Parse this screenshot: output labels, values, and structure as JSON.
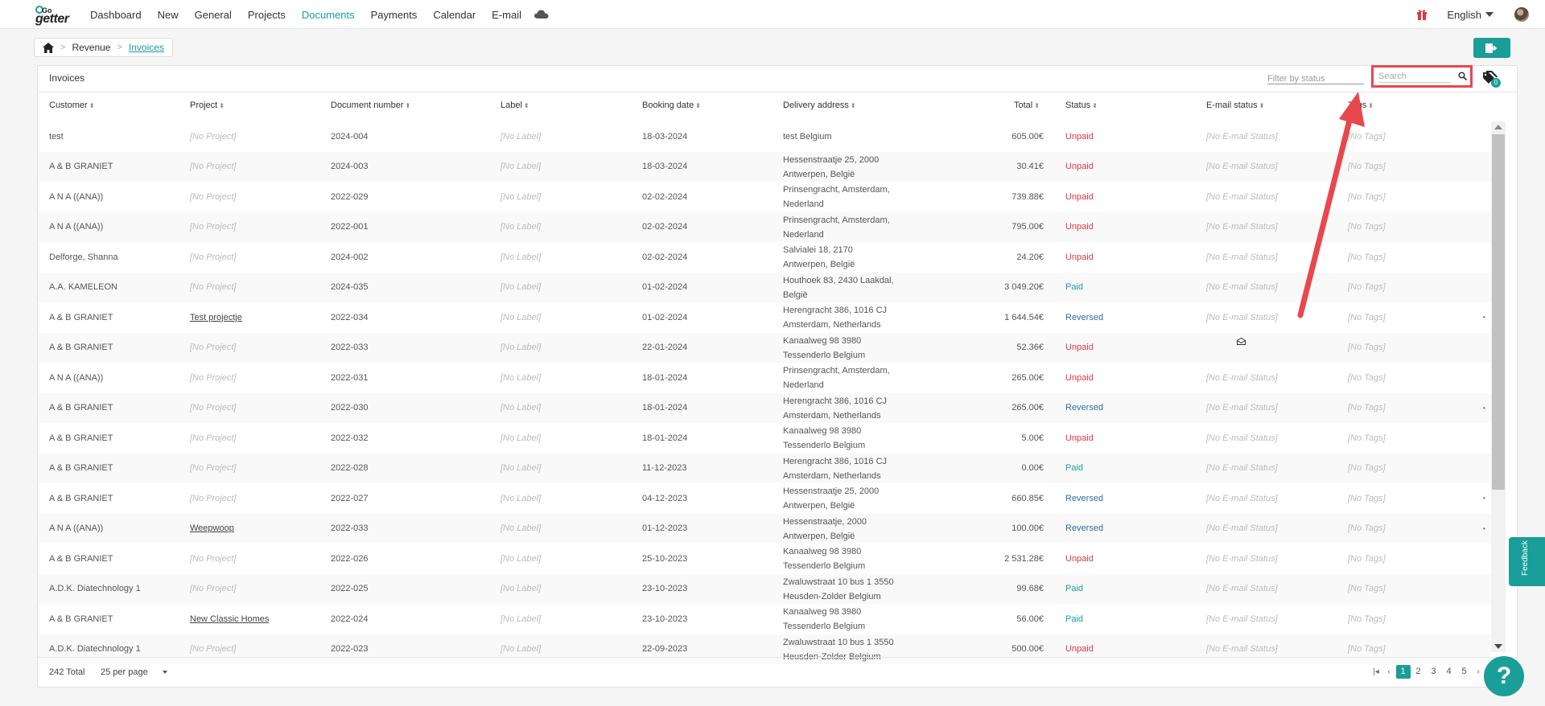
{
  "nav": {
    "logo_top": "Go",
    "logo_bottom": "getter",
    "items": [
      "Dashboard",
      "New",
      "General",
      "Projects",
      "Documents",
      "Payments",
      "Calendar",
      "E-mail"
    ],
    "active": "Documents",
    "language": "English"
  },
  "breadcrumb": {
    "items": [
      "Revenue",
      "Invoices"
    ]
  },
  "panel": {
    "title": "Invoices",
    "filter_placeholder": "Filter by status",
    "search_placeholder": "Search",
    "tag_count": "0"
  },
  "columns": [
    "Customer",
    "Project",
    "Document number",
    "Label",
    "Booking date",
    "Delivery address",
    "Total",
    "Status",
    "E-mail status",
    "Tags"
  ],
  "rows": [
    {
      "customer": "test",
      "project": "[No Project]",
      "doc": "2024-004",
      "label": "[No Label]",
      "date": "18-03-2024",
      "addr1": "test Belgium",
      "addr2": "",
      "total": "605.00€",
      "status": "Unpaid",
      "email": "[No E-mail Status]",
      "tags": "[No Tags]"
    },
    {
      "customer": "A & B GRANIET",
      "project": "[No Project]",
      "doc": "2024-003",
      "label": "[No Label]",
      "date": "18-03-2024",
      "addr1": "Hessenstraatje 25, 2000",
      "addr2": "Antwerpen, België",
      "total": "30.41€",
      "status": "Unpaid",
      "email": "[No E-mail Status]",
      "tags": "[No Tags]"
    },
    {
      "customer": "A N A ((ANA))",
      "project": "[No Project]",
      "doc": "2022-029",
      "label": "[No Label]",
      "date": "02-02-2024",
      "addr1": "Prinsengracht, Amsterdam,",
      "addr2": "Nederland",
      "total": "739.88€",
      "status": "Unpaid",
      "email": "[No E-mail Status]",
      "tags": "[No Tags]"
    },
    {
      "customer": "A N A ((ANA))",
      "project": "[No Project]",
      "doc": "2022-001",
      "label": "[No Label]",
      "date": "02-02-2024",
      "addr1": "Prinsengracht, Amsterdam,",
      "addr2": "Nederland",
      "total": "795.00€",
      "status": "Unpaid",
      "email": "[No E-mail Status]",
      "tags": "[No Tags]"
    },
    {
      "customer": "Delforge, Shanna",
      "project": "[No Project]",
      "doc": "2024-002",
      "label": "[No Label]",
      "date": "02-02-2024",
      "addr1": "Salvialei 18, 2170",
      "addr2": "Antwerpen, België",
      "total": "24.20€",
      "status": "Unpaid",
      "email": "[No E-mail Status]",
      "tags": "[No Tags]"
    },
    {
      "customer": "A.A. KAMELEON",
      "project": "[No Project]",
      "doc": "2024-035",
      "label": "[No Label]",
      "date": "01-02-2024",
      "addr1": "Houthoek 83, 2430 Laakdal,",
      "addr2": "België",
      "total": "3 049.20€",
      "status": "Paid",
      "email": "[No E-mail Status]",
      "tags": "[No Tags]"
    },
    {
      "customer": "A & B GRANIET",
      "project": "Test projectje",
      "doc": "2022-034",
      "label": "[No Label]",
      "date": "01-02-2024",
      "addr1": "Herengracht 386, 1016 CJ",
      "addr2": "Amsterdam, Netherlands",
      "total": "1 644.54€",
      "status": "Reversed",
      "email": "[No E-mail Status]",
      "tags": "[No Tags]"
    },
    {
      "customer": "A & B GRANIET",
      "project": "[No Project]",
      "doc": "2022-033",
      "label": "[No Label]",
      "date": "22-01-2024",
      "addr1": "Kanaalweg 98 3980",
      "addr2": "Tessenderlo Belgium",
      "total": "52.36€",
      "status": "Unpaid",
      "email": "",
      "tags": "[No Tags]"
    },
    {
      "customer": "A N A ((ANA))",
      "project": "[No Project]",
      "doc": "2022-031",
      "label": "[No Label]",
      "date": "18-01-2024",
      "addr1": "Prinsengracht, Amsterdam,",
      "addr2": "Nederland",
      "total": "265.00€",
      "status": "Unpaid",
      "email": "[No E-mail Status]",
      "tags": "[No Tags]"
    },
    {
      "customer": "A & B GRANIET",
      "project": "[No Project]",
      "doc": "2022-030",
      "label": "[No Label]",
      "date": "18-01-2024",
      "addr1": "Herengracht 386, 1016 CJ",
      "addr2": "Amsterdam, Netherlands",
      "total": "265.00€",
      "status": "Reversed",
      "email": "[No E-mail Status]",
      "tags": "[No Tags]"
    },
    {
      "customer": "A & B GRANIET",
      "project": "[No Project]",
      "doc": "2022-032",
      "label": "[No Label]",
      "date": "18-01-2024",
      "addr1": "Kanaalweg 98 3980",
      "addr2": "Tessenderlo Belgium",
      "total": "5.00€",
      "status": "Unpaid",
      "email": "[No E-mail Status]",
      "tags": "[No Tags]"
    },
    {
      "customer": "A & B GRANIET",
      "project": "[No Project]",
      "doc": "2022-028",
      "label": "[No Label]",
      "date": "11-12-2023",
      "addr1": "Herengracht 386, 1016 CJ",
      "addr2": "Amsterdam, Netherlands",
      "total": "0.00€",
      "status": "Paid",
      "email": "[No E-mail Status]",
      "tags": "[No Tags]"
    },
    {
      "customer": "A & B GRANIET",
      "project": "[No Project]",
      "doc": "2022-027",
      "label": "[No Label]",
      "date": "04-12-2023",
      "addr1": "Hessenstraatje 25, 2000",
      "addr2": "Antwerpen, België",
      "total": "660.85€",
      "status": "Reversed",
      "email": "[No E-mail Status]",
      "tags": "[No Tags]"
    },
    {
      "customer": "A N A ((ANA))",
      "project": "Weepwoop",
      "doc": "2022-033",
      "label": "[No Label]",
      "date": "01-12-2023",
      "addr1": "Hessenstraatje, 2000",
      "addr2": "Antwerpen, België",
      "total": "100.00€",
      "status": "Reversed",
      "email": "[No E-mail Status]",
      "tags": "[No Tags]"
    },
    {
      "customer": "A & B GRANIET",
      "project": "[No Project]",
      "doc": "2022-026",
      "label": "[No Label]",
      "date": "25-10-2023",
      "addr1": "Kanaalweg 98 3980",
      "addr2": "Tessenderlo Belgium",
      "total": "2 531.28€",
      "status": "Unpaid",
      "email": "[No E-mail Status]",
      "tags": "[No Tags]"
    },
    {
      "customer": "A.D.K. Diatechnology 1",
      "project": "[No Project]",
      "doc": "2022-025",
      "label": "[No Label]",
      "date": "23-10-2023",
      "addr1": "Zwaluwstraat 10 bus 1 3550",
      "addr2": "Heusden-Zolder Belgium",
      "total": "99.68€",
      "status": "Paid",
      "email": "[No E-mail Status]",
      "tags": "[No Tags]"
    },
    {
      "customer": "A & B GRANIET",
      "project": "New Classic Homes",
      "doc": "2022-024",
      "label": "[No Label]",
      "date": "23-10-2023",
      "addr1": "Kanaalweg 98 3980",
      "addr2": "Tessenderlo Belgium",
      "total": "56.00€",
      "status": "Paid",
      "email": "[No E-mail Status]",
      "tags": "[No Tags]"
    },
    {
      "customer": "A.D.K. Diatechnology 1",
      "project": "[No Project]",
      "doc": "2022-023",
      "label": "[No Label]",
      "date": "22-09-2023",
      "addr1": "Zwaluwstraat 10 bus 1 3550",
      "addr2": "Heusden-Zolder Belgium",
      "total": "500.00€",
      "status": "Unpaid",
      "email": "[No E-mail Status]",
      "tags": "[No Tags]"
    }
  ],
  "footer": {
    "total": "242 Total",
    "per_page": "25 per page",
    "pages": [
      "1",
      "2",
      "3",
      "4",
      "5"
    ],
    "current_page": "1"
  },
  "feedback_label": "Feedback",
  "help_label": "?",
  "colors": {
    "accent": "#1a9e9a",
    "unpaid": "#e0383e",
    "paid": "#1a9e9a",
    "reversed": "#2b6fa0",
    "highlight": "#e8474e"
  }
}
